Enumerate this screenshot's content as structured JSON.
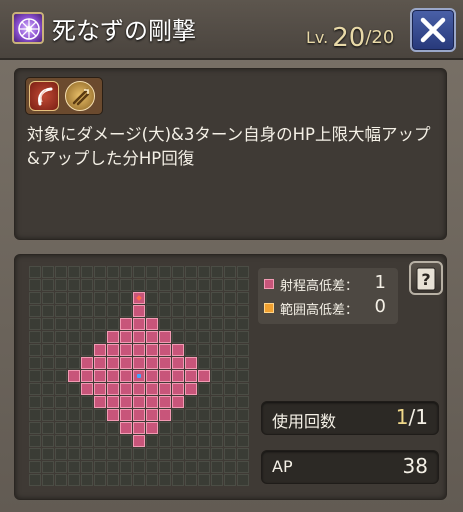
{
  "header": {
    "title": "死なずの剛撃",
    "level_label": "Lv.",
    "level_current": "20",
    "level_max": "/20",
    "skill_icon": "purple-star-emblem-icon",
    "close_icon": "close-x-icon"
  },
  "description": {
    "type_icons": [
      "slash-attack-icon",
      "element-orb-icon"
    ],
    "text": "対象にダメージ(大)&3ターン自身のHP上限大幅アップ&アップした分HP回復"
  },
  "range": {
    "legend": [
      {
        "label": "射程高低差：",
        "value": "1",
        "color": "#c8557a"
      },
      {
        "label": "範囲高低差：",
        "value": "0",
        "color": "#f0a030"
      }
    ],
    "help_icon": "help-question-icon"
  },
  "stats": {
    "uses_label": "使用回数",
    "uses_current": "1",
    "uses_max": "/1",
    "ap_label": "AP",
    "ap_value": "38"
  },
  "colors": {
    "target_cell": "#c8557a",
    "center_marker": "#43a5ff",
    "top_marker": "#ff6a4a",
    "close_button": "#3a4f96"
  }
}
